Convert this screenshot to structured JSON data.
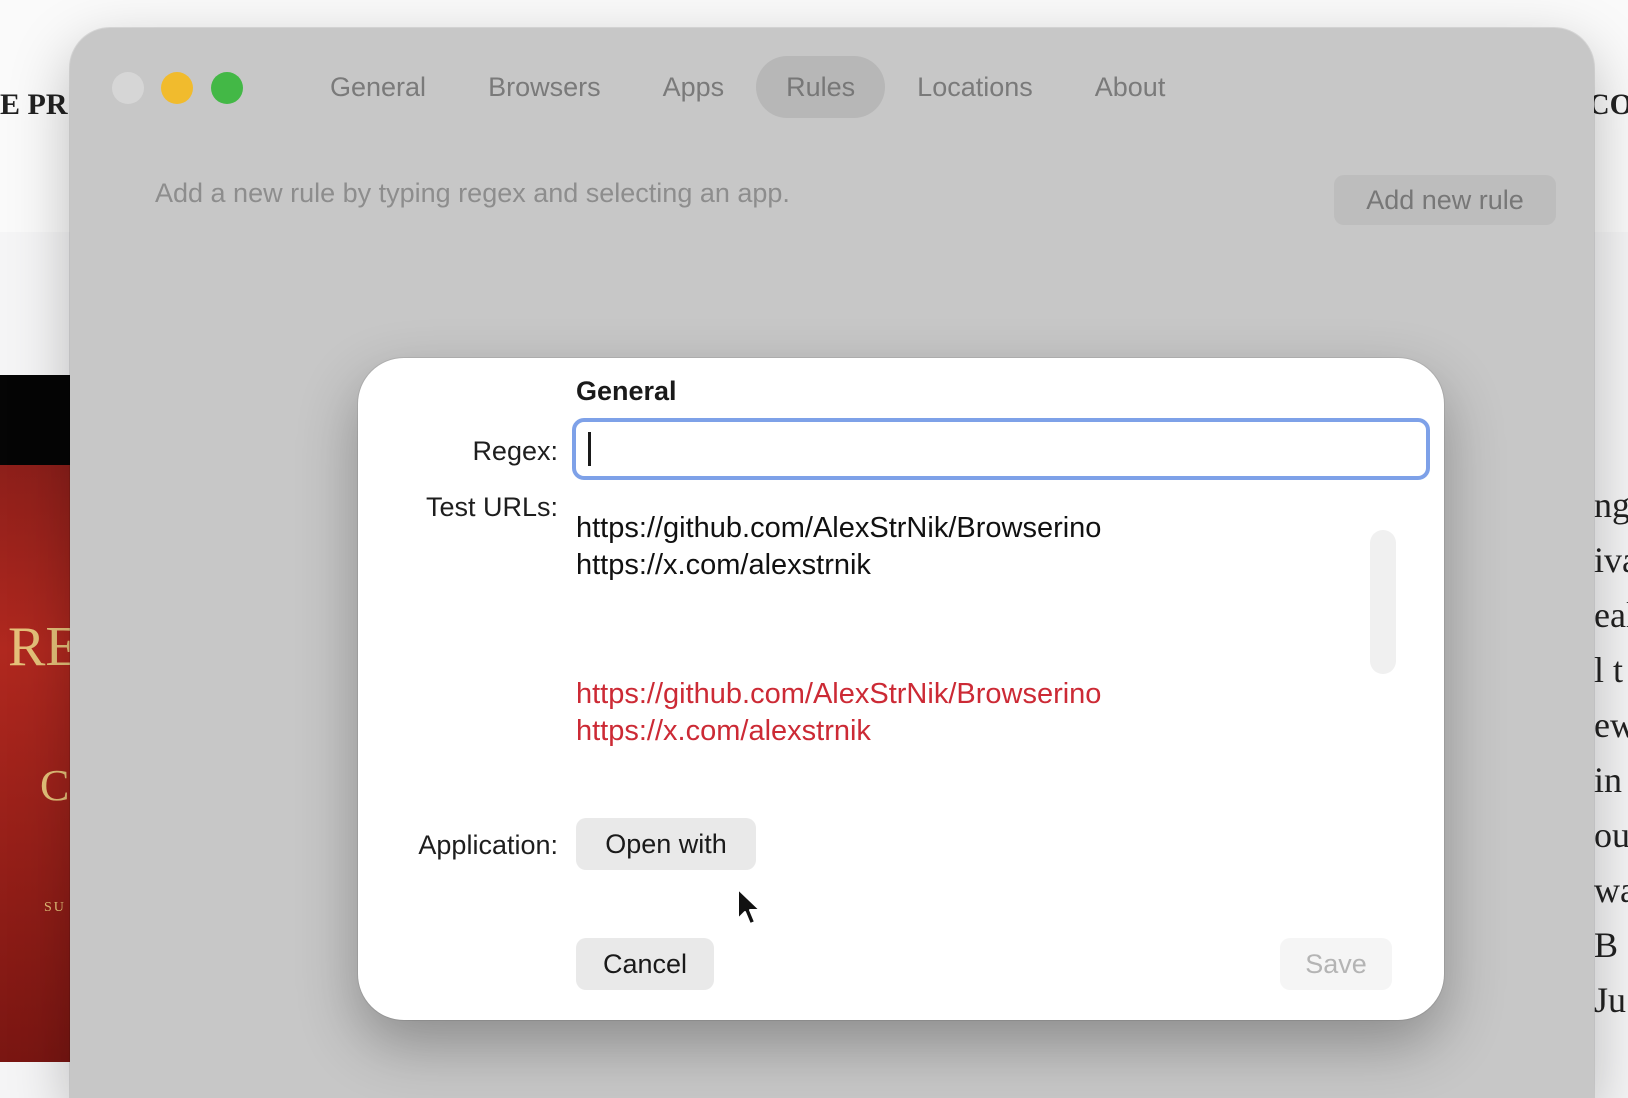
{
  "background": {
    "left_text": "E PR",
    "right_text": "CO",
    "book": {
      "title": "RE",
      "subtitle": "C",
      "small": "SU"
    },
    "article_fragments": [
      "ng",
      "iva",
      "eal",
      "l t",
      "ew",
      "in",
      "ou",
      "wa",
      "B",
      "Ju"
    ]
  },
  "window": {
    "tabs": [
      {
        "label": "General"
      },
      {
        "label": "Browsers"
      },
      {
        "label": "Apps"
      },
      {
        "label": "Rules",
        "active": true
      },
      {
        "label": "Locations"
      },
      {
        "label": "About"
      }
    ],
    "hint": "Add a new rule by typing regex and selecting an app.",
    "add_button": "Add new rule"
  },
  "dialog": {
    "section_title": "General",
    "regex_label": "Regex:",
    "regex_value": "",
    "test_urls_label": "Test URLs:",
    "test_urls": [
      "https://github.com/AlexStrNik/Browserino",
      "https://x.com/alexstrnik"
    ],
    "matched_urls": [
      "https://github.com/AlexStrNik/Browserino",
      "https://x.com/alexstrnik"
    ],
    "match_color": "#cc2a35",
    "application_label": "Application:",
    "open_with_button": "Open with",
    "cancel_button": "Cancel",
    "save_button": "Save"
  },
  "colors": {
    "focus_ring": "#7ea1e8",
    "close": "#d6d6d6",
    "minimize": "#f1bb2d",
    "maximize": "#43b846"
  }
}
